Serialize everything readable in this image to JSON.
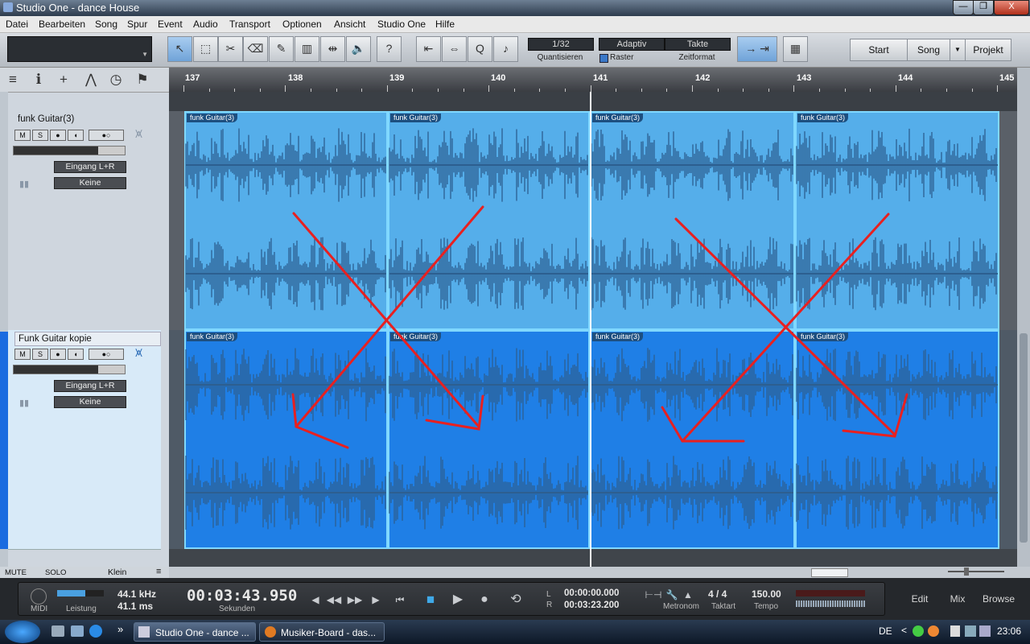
{
  "window": {
    "title": "Studio One - dance House",
    "min_label": "—",
    "max_label": "❐",
    "close_label": "X"
  },
  "menu": [
    "Datei",
    "Bearbeiten",
    "Song",
    "Spur",
    "Event",
    "Audio",
    "Transport",
    "Optionen",
    "Ansicht",
    "Studio One",
    "Hilfe"
  ],
  "toolbar": {
    "quantize": {
      "value": "1/32",
      "label": "Quantisieren"
    },
    "grid": {
      "value": "Adaptiv",
      "label": "Raster"
    },
    "timeformat": {
      "value": "Takte",
      "label": "Zeitformat"
    },
    "nav": {
      "start": "Start",
      "song": "Song",
      "project": "Projekt"
    }
  },
  "tracks": [
    {
      "name": "funk Guitar(3)",
      "input": "Eingang L+R",
      "output": "Keine",
      "m": "M",
      "s": "S"
    },
    {
      "name": "Funk Guitar kopie",
      "input": "Eingang L+R",
      "output": "Keine",
      "m": "M",
      "s": "S"
    }
  ],
  "ruler": {
    "bars": [
      "137",
      "138",
      "139",
      "140",
      "141",
      "142",
      "143",
      "144",
      "145"
    ]
  },
  "clips": {
    "label": "funk Guitar(3)"
  },
  "leftfooter": {
    "mute": "MUTE",
    "solo": "SOLO",
    "size": "Klein"
  },
  "transport": {
    "midi": "MIDI",
    "perf_label": "Leistung",
    "samplerate": "44.1 kHz",
    "latency": "41.1 ms",
    "time": "00:03:43.950",
    "time_label": "Sekunden",
    "loop_l_label": "L",
    "loop_r_label": "R",
    "loop_l": "00:00:00.000",
    "loop_r": "00:03:23.200",
    "metronome": "Metronom",
    "timesig": "4 / 4",
    "timesig_label": "Taktart",
    "tempo": "150.00",
    "tempo_label": "Tempo",
    "edit": "Edit",
    "mix": "Mix",
    "browse": "Browse"
  },
  "taskbar": {
    "tasks": [
      "Studio One - dance ...",
      "Musiker-Board - das..."
    ],
    "lang": "DE",
    "clock": "23:06",
    "more": "»"
  },
  "colors": {
    "lane1": "#55aeea",
    "lane2": "#1f7fe6",
    "waveform": "#2d5f90",
    "annotation": "#e82020"
  }
}
